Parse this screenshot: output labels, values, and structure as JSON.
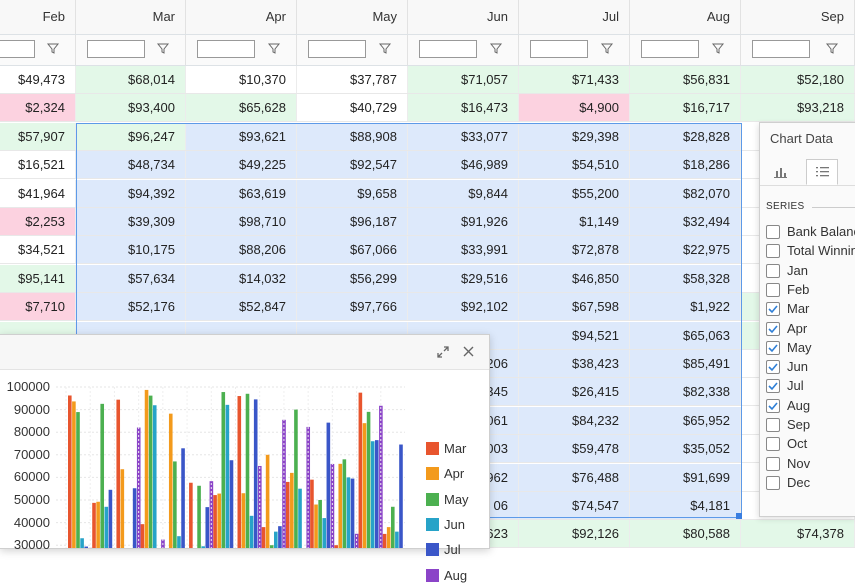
{
  "columns": [
    "Feb",
    "Mar",
    "Apr",
    "May",
    "Jun",
    "Jul",
    "Aug",
    "Sep"
  ],
  "rows": [
    {
      "cells": [
        "$49,473",
        "$68,014",
        "$10,370",
        "$37,787",
        "$71,057",
        "$71,433",
        "$56,831",
        "$52,180"
      ]
    },
    {
      "cells": [
        "$2,324",
        "$93,400",
        "$65,628",
        "$40,729",
        "$16,473",
        "$4,900",
        "$16,717",
        "$93,218"
      ]
    },
    {
      "cells": [
        "$57,907",
        "$96,247",
        "$93,621",
        "$88,908",
        "$33,077",
        "$29,398",
        "$28,828",
        ""
      ]
    },
    {
      "cells": [
        "$16,521",
        "$48,734",
        "$49,225",
        "$92,547",
        "$46,989",
        "$54,510",
        "$18,286",
        ""
      ]
    },
    {
      "cells": [
        "$41,964",
        "$94,392",
        "$63,619",
        "$9,658",
        "$9,844",
        "$55,200",
        "$82,070",
        ""
      ]
    },
    {
      "cells": [
        "$2,253",
        "$39,309",
        "$98,710",
        "$96,187",
        "$91,926",
        "$1,149",
        "$32,494",
        ""
      ]
    },
    {
      "cells": [
        "$34,521",
        "$10,175",
        "$88,206",
        "$67,066",
        "$33,991",
        "$72,878",
        "$22,975",
        ""
      ]
    },
    {
      "cells": [
        "$95,141",
        "$57,634",
        "$14,032",
        "$56,299",
        "$29,516",
        "$46,850",
        "$58,328",
        ""
      ]
    },
    {
      "cells": [
        "$7,710",
        "$52,176",
        "$52,847",
        "$97,766",
        "$92,102",
        "$67,598",
        "$1,922",
        ""
      ]
    },
    {
      "cells": [
        "",
        "",
        "",
        "",
        "",
        "$94,521",
        "$65,063",
        ""
      ]
    },
    {
      "cells": [
        "",
        "",
        "",
        "",
        "206",
        "$38,423",
        "$85,491",
        ""
      ]
    },
    {
      "cells": [
        "",
        "",
        "",
        "",
        "345",
        "$26,415",
        "$82,338",
        ""
      ]
    },
    {
      "cells": [
        "",
        "",
        "",
        "",
        "061",
        "$84,232",
        "$65,952",
        ""
      ]
    },
    {
      "cells": [
        "",
        "",
        "",
        "",
        "003",
        "$59,478",
        "$35,052",
        ""
      ]
    },
    {
      "cells": [
        "",
        "",
        "",
        "",
        "962",
        "$76,488",
        "$91,699",
        ""
      ]
    },
    {
      "cells": [
        "",
        "",
        "",
        "",
        "06",
        "$74,547",
        "$4,181",
        ""
      ]
    },
    {
      "cells": [
        "",
        "",
        "",
        "",
        "623",
        "$92,126",
        "$80,588",
        "$74,378"
      ]
    }
  ],
  "panel": {
    "title": "Chart Data",
    "section": "SERIES",
    "series": [
      {
        "label": "Bank Balance",
        "checked": false
      },
      {
        "label": "Total Winnings",
        "checked": false
      },
      {
        "label": "Jan",
        "checked": false
      },
      {
        "label": "Feb",
        "checked": false
      },
      {
        "label": "Mar",
        "checked": true
      },
      {
        "label": "Apr",
        "checked": true
      },
      {
        "label": "May",
        "checked": true
      },
      {
        "label": "Jun",
        "checked": true
      },
      {
        "label": "Jul",
        "checked": true
      },
      {
        "label": "Aug",
        "checked": true
      },
      {
        "label": "Sep",
        "checked": false
      },
      {
        "label": "Oct",
        "checked": false
      },
      {
        "label": "Nov",
        "checked": false
      },
      {
        "label": "Dec",
        "checked": false
      }
    ]
  },
  "chart_data": {
    "type": "bar",
    "ylim": [
      30000,
      100000
    ],
    "yticks": [
      "100000",
      "90000",
      "80000",
      "70000",
      "60000",
      "50000",
      "40000",
      "30000"
    ],
    "series": [
      {
        "name": "Mar",
        "color": "#e8552e",
        "values": [
          96247,
          48734,
          94392,
          39309,
          10175,
          57634,
          52176,
          96000,
          38000,
          58000,
          59000,
          30000,
          97500,
          35000
        ]
      },
      {
        "name": "Apr",
        "color": "#f39a1c",
        "values": [
          93621,
          49225,
          63619,
          98710,
          88206,
          14032,
          52847,
          53000,
          70000,
          62000,
          48000,
          66000,
          84000,
          38000
        ]
      },
      {
        "name": "May",
        "color": "#4cb050",
        "values": [
          88908,
          92547,
          9658,
          96187,
          67066,
          56299,
          97766,
          97000,
          30000,
          90000,
          50000,
          68000,
          89000,
          47000
        ]
      },
      {
        "name": "Jun",
        "color": "#27a3c8",
        "values": [
          33077,
          46989,
          9844,
          91926,
          33991,
          29516,
          92102,
          43000,
          36000,
          55000,
          42000,
          60000,
          76000,
          36000
        ]
      },
      {
        "name": "Jul",
        "color": "#3a56c8",
        "values": [
          29398,
          54510,
          55200,
          1149,
          72878,
          46850,
          67598,
          94521,
          38423,
          26415,
          84232,
          59478,
          76488,
          74547
        ]
      },
      {
        "name": "Aug",
        "color": "#8b44c8",
        "values": [
          28828,
          18286,
          82070,
          32494,
          22975,
          58328,
          1922,
          65063,
          85491,
          82338,
          65952,
          35052,
          91699,
          4181
        ]
      }
    ]
  },
  "colors": {
    "positive": "#e3f8e8",
    "negative": "#fcd2e0",
    "selected": "#dde9fb",
    "accent": "#3a7ee0"
  },
  "icons": {
    "filter": "filter-icon",
    "expand": "expand-icon",
    "close": "close-icon",
    "chart_tab": "bar-chart-icon",
    "list_tab": "list-icon"
  }
}
